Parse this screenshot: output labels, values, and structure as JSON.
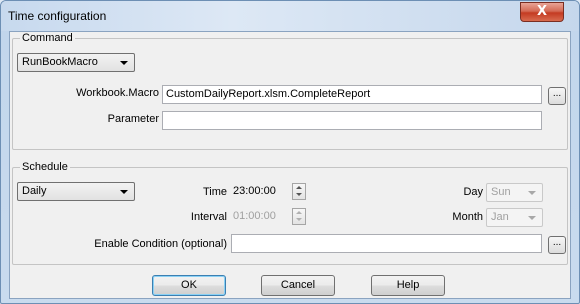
{
  "window": {
    "title": "Time configuration",
    "close_glyph": "X"
  },
  "command": {
    "group_label": "Command",
    "type_value": "RunBookMacro",
    "workbook_label": "Workbook.Macro",
    "workbook_value": "CustomDailyReport.xlsm.CompleteReport",
    "parameter_label": "Parameter",
    "parameter_value": "",
    "browse_label": "..."
  },
  "schedule": {
    "group_label": "Schedule",
    "frequency_value": "Daily",
    "time_label": "Time",
    "time_value": "23:00:00",
    "interval_label": "Interval",
    "interval_value": "01:00:00",
    "day_label": "Day",
    "day_value": "Sun",
    "month_label": "Month",
    "month_value": "Jan",
    "condition_label": "Enable Condition (optional)",
    "condition_value": "",
    "browse_label": "..."
  },
  "buttons": {
    "ok": "OK",
    "cancel": "Cancel",
    "help": "Help"
  }
}
